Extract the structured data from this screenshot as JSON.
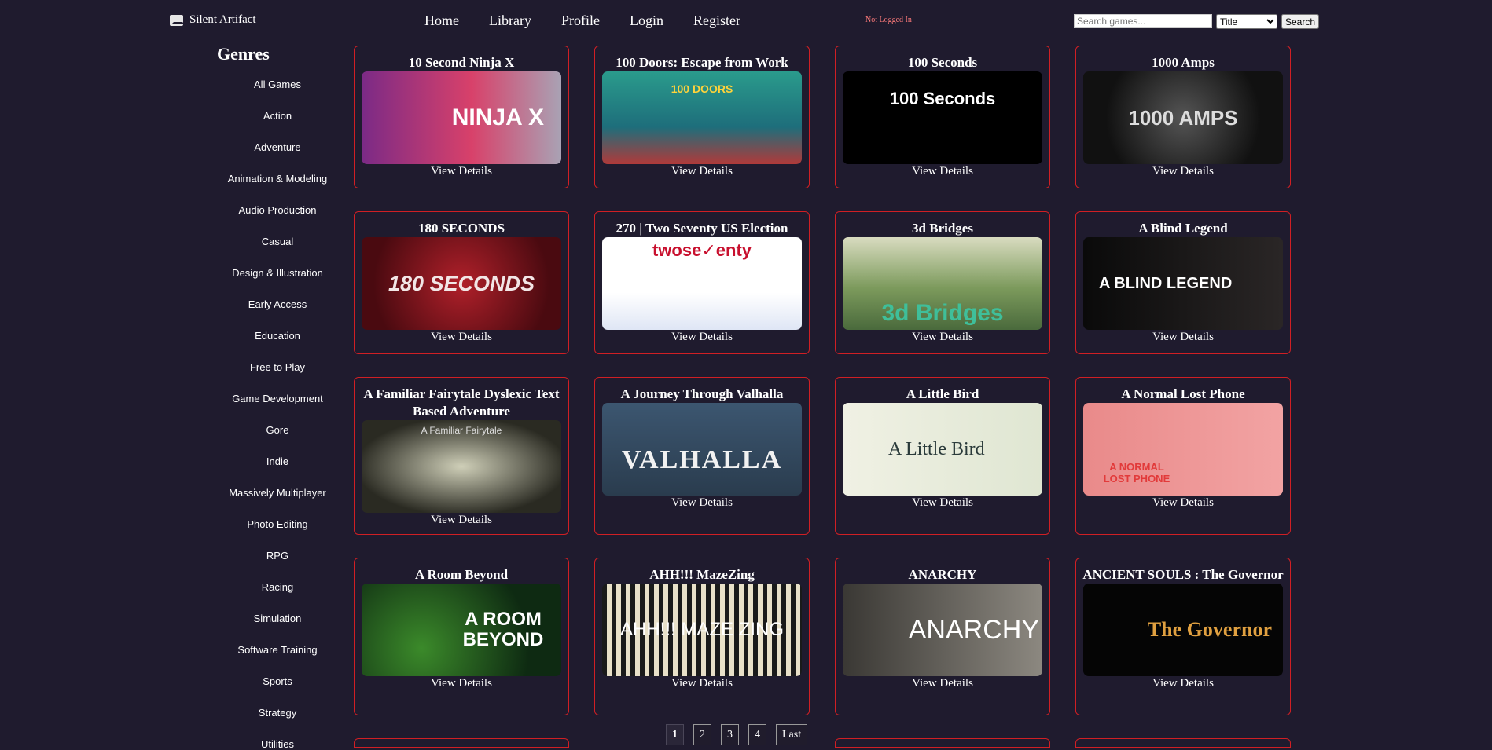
{
  "brand": {
    "name": "Silent Artifact",
    "icon": "mail-icon"
  },
  "nav": {
    "home": "Home",
    "library": "Library",
    "profile": "Profile",
    "login": "Login",
    "register": "Register",
    "status": "Not Logged In"
  },
  "search": {
    "placeholder": "Search games...",
    "filter_value": "Title",
    "button": "Search"
  },
  "sidebar": {
    "heading": "Genres",
    "items": [
      "All Games",
      "Action",
      "Adventure",
      "Animation & Modeling",
      "Audio Production",
      "Casual",
      "Design & Illustration",
      "Early Access",
      "Education",
      "Free to Play",
      "Game Development",
      "Gore",
      "Indie",
      "Massively Multiplayer",
      "Photo Editing",
      "RPG",
      "Racing",
      "Simulation",
      "Software Training",
      "Sports",
      "Strategy",
      "Utilities"
    ]
  },
  "cards": [
    {
      "title": "10 Second Ninja X",
      "art": "NINJA X",
      "details": "View Details"
    },
    {
      "title": "100 Doors: Escape from Work",
      "art": "100 DOORS",
      "details": "View Details"
    },
    {
      "title": "100 Seconds",
      "art": "100 Seconds",
      "details": "View Details"
    },
    {
      "title": "1000 Amps",
      "art": "1000 AMPS",
      "details": "View Details"
    },
    {
      "title": "180 SECONDS",
      "art": "180 SECONDS",
      "details": "View Details"
    },
    {
      "title": "270 | Two Seventy US Election",
      "art": "twose✓enty",
      "details": "View Details"
    },
    {
      "title": "3d Bridges",
      "art": "3d Bridges",
      "details": "View Details"
    },
    {
      "title": "A Blind Legend",
      "art": "A BLIND LEGEND",
      "details": "View Details"
    },
    {
      "title": "A Familiar Fairytale Dyslexic Text Based Adventure",
      "art": "A Familiar Fairytale",
      "details": "View Details"
    },
    {
      "title": "A Journey Through Valhalla",
      "art": "VALHALLA",
      "details": "View Details"
    },
    {
      "title": "A Little Bird",
      "art": "A Little Bird",
      "details": "View Details"
    },
    {
      "title": "A Normal Lost Phone",
      "art": "A NORMAL LOST PHONE",
      "details": "View Details"
    },
    {
      "title": "A Room Beyond",
      "art": "A ROOM BEYOND",
      "details": "View Details"
    },
    {
      "title": "AHH!!! MazeZing",
      "art": "AHH!!! MAZE ZING",
      "details": "View Details"
    },
    {
      "title": "ANARCHY",
      "art": "ANARCHY",
      "details": "View Details"
    },
    {
      "title": "ANCIENT SOULS : The Governor",
      "art": "The Governor",
      "details": "View Details"
    }
  ],
  "pagination": {
    "pages": [
      "1",
      "2",
      "3",
      "4"
    ],
    "last": "Last",
    "current": "1"
  },
  "colors": {
    "background": "#1f1b2e",
    "card_border": "#d01f24",
    "status": "#ff7b7b"
  }
}
